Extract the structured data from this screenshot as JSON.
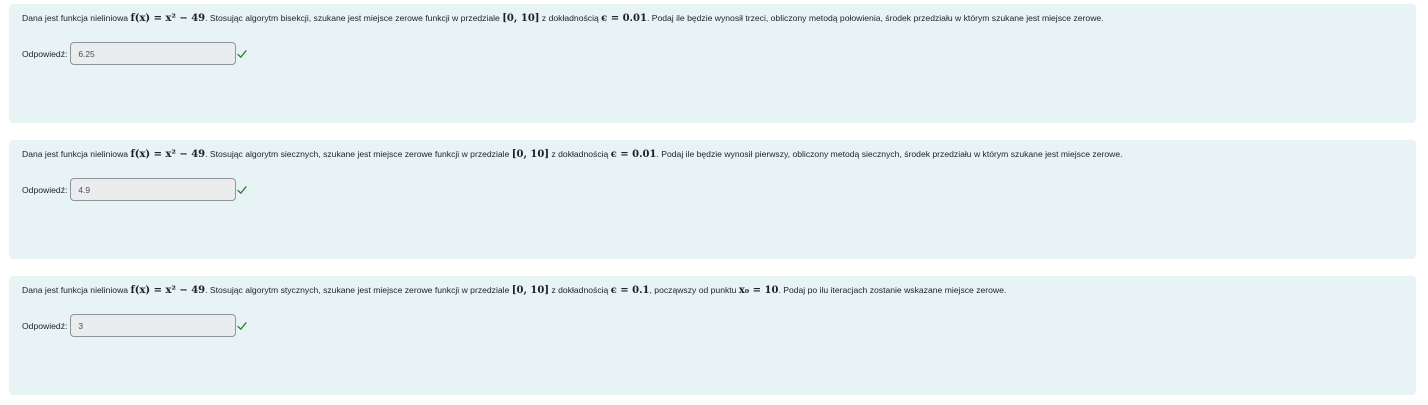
{
  "questions": [
    {
      "prefix": "Dana jest funkcja nieliniowa ",
      "function_expr": "f(x) = x² − 49",
      "mid1": ". Stosując algorytm bisekcji, szukane jest miejsce zerowe funkcji w przedziale ",
      "interval": "[0, 10]",
      "mid2": " z dokładnością ",
      "epsilon": "ϵ = 0.01",
      "suffix": ". Podaj ile będzie wynosił trzeci, obliczony metodą połowienia, środek przedziału w którym szukane jest miejsce zerowe.",
      "answer_label": "Odpowiedź:",
      "answer_value": "6.25",
      "status_icon": "check-icon",
      "status_color": "#2e7d32"
    },
    {
      "prefix": "Dana jest funkcja nieliniowa ",
      "function_expr": "f(x) = x² − 49",
      "mid1": ". Stosując algorytm siecznych, szukane jest miejsce zerowe funkcji w przedziale ",
      "interval": "[0, 10]",
      "mid2": " z dokładnością ",
      "epsilon": "ϵ = 0.01",
      "suffix": ". Podaj ile będzie wynosił pierwszy, obliczony metodą siecznych, środek przedziału w którym szukane jest miejsce zerowe.",
      "answer_label": "Odpowiedź:",
      "answer_value": "4.9",
      "status_icon": "check-icon",
      "status_color": "#2e7d32"
    },
    {
      "prefix": "Dana jest funkcja nieliniowa ",
      "function_expr": "f(x) = x² − 49",
      "mid1": ". Stosując algorytm stycznych, szukane jest miejsce zerowe funkcji w przedziale ",
      "interval": "[0, 10]",
      "mid2": " z dokładnością ",
      "epsilon": "ϵ = 0.1",
      "mid3": ", począwszy od punktu ",
      "start_point": "x₀ = 10",
      "suffix": ". Podaj po ilu iteracjach zostanie wskazane miejsce zerowe.",
      "answer_label": "Odpowiedź:",
      "answer_value": "3",
      "status_icon": "check-icon",
      "status_color": "#2e7d32"
    }
  ],
  "colors": {
    "card_background": "#e7f3f5",
    "input_background": "#eaecee",
    "correct": "#2e7d32"
  }
}
